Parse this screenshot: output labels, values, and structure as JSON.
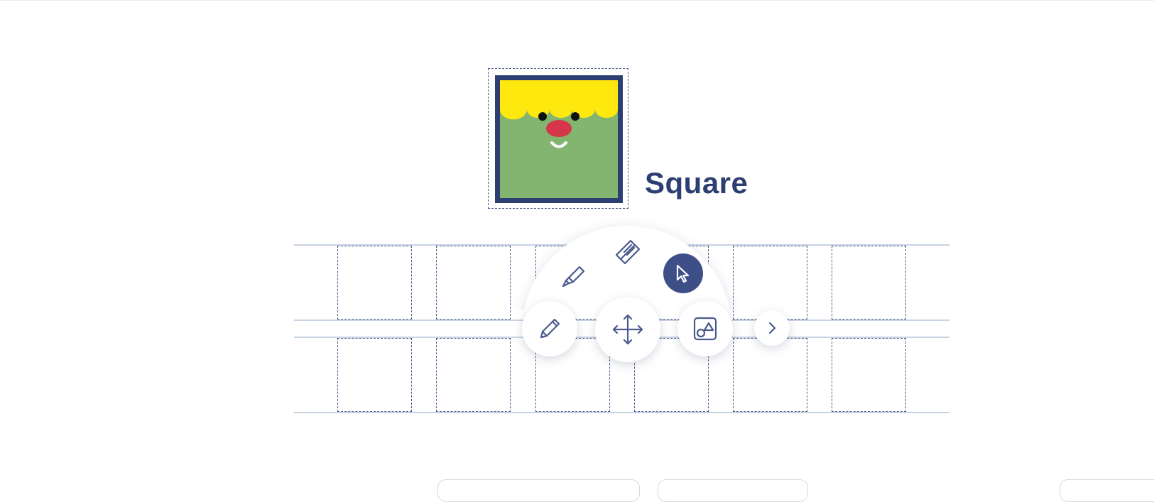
{
  "shape": {
    "name": "Square",
    "colors": {
      "border": "#2d3e72",
      "hair": "#ffe80e",
      "face": "#82b56f",
      "nose": "#d7354a",
      "eyes": "#111111",
      "smile": "#ffffff"
    }
  },
  "worksheet": {
    "rows": 2,
    "boxes_per_row": 6,
    "colors": {
      "guide": "#c7d2e2",
      "dash": "#4a5b8e"
    }
  },
  "toolbar": {
    "tools": [
      {
        "id": "pencil",
        "icon": "pencil-icon"
      },
      {
        "id": "marker",
        "icon": "marker-icon"
      },
      {
        "id": "eraser",
        "icon": "eraser-icon"
      },
      {
        "id": "pointer",
        "icon": "pointer-icon",
        "selected": true
      },
      {
        "id": "shapes",
        "icon": "shapes-icon"
      },
      {
        "id": "move",
        "icon": "move-icon"
      }
    ],
    "next_icon": "chevron-right-icon",
    "colors": {
      "accent": "#3d4f86",
      "icon": "#4a5b8e"
    }
  }
}
